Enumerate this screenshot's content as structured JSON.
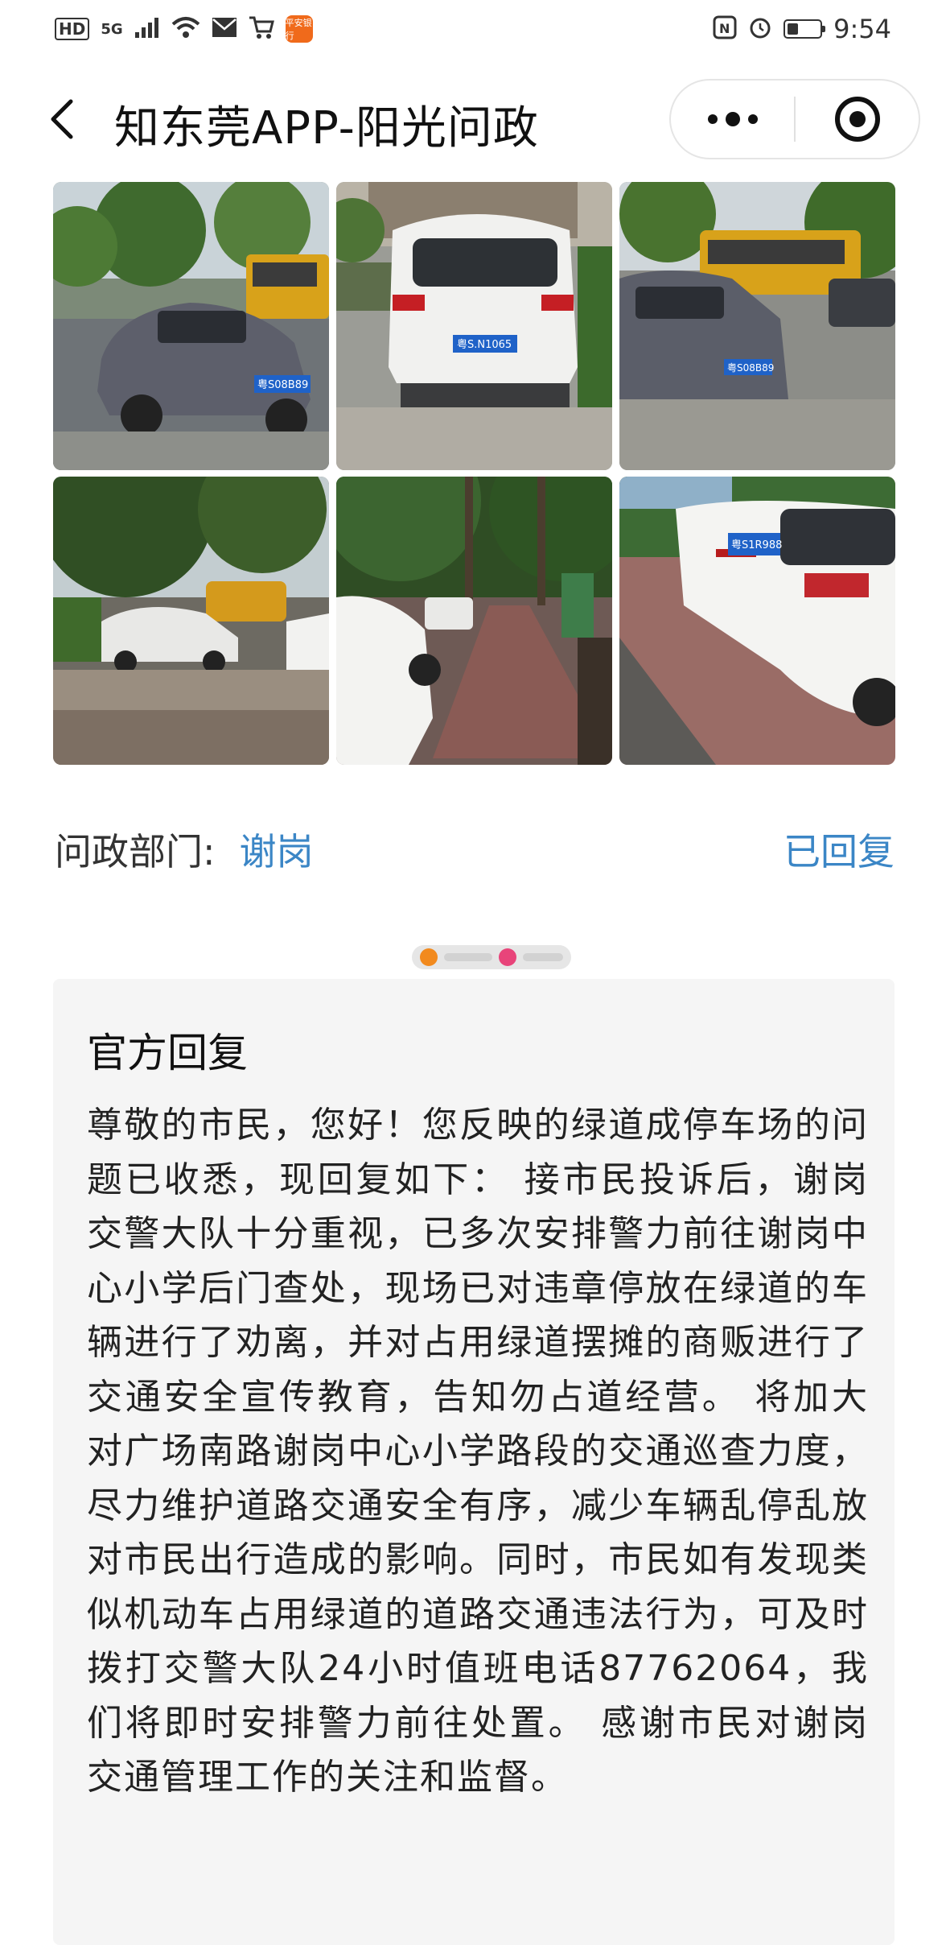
{
  "status_bar": {
    "left": [
      "HD",
      "5G"
    ],
    "app_badge": "平安银行",
    "time": "9:54",
    "icons": [
      "signal-icon",
      "wifi-icon",
      "mail-icon",
      "cart-icon",
      "nfc-icon",
      "alarm-icon",
      "battery-icon"
    ],
    "battery_level": 0.35
  },
  "header": {
    "title": "知东莞APP-阳光问政",
    "icons": [
      "back-icon",
      "more-icon",
      "record-icon"
    ]
  },
  "photos": [
    {
      "plate": "粤S08B89"
    },
    {
      "plate": "粤S.N1065"
    },
    {
      "plate": "粤S08B89"
    },
    {
      "plate": ""
    },
    {
      "plate": ""
    },
    {
      "plate": "粤S1R988"
    }
  ],
  "dept": {
    "label": "问政部门:",
    "value": "谢岗",
    "status": "已回复"
  },
  "reply": {
    "title": "官方回复",
    "body": "尊敬的市民，您好！您反映的绿道成停车场的问题已收悉，现回复如下： 接市民投诉后，谢岗交警大队十分重视，已多次安排警力前往谢岗中心小学后门查处，现场已对违章停放在绿道的车辆进行了劝离，并对占用绿道摆摊的商贩进行了交通安全宣传教育，告知勿占道经营。 将加大对广场南路谢岗中心小学路段的交通巡查力度，尽力维护道路交通安全有序，减少车辆乱停乱放对市民出行造成的影响。同时，市民如有发现类似机动车占用绿道的道路交通违法行为，可及时拨打交警大队24小时值班电话87762064，我们将即时安排警力前往处置。 感谢市民对谢岗交通管理工作的关注和监督。"
  },
  "colors": {
    "accent": "#3b86c6",
    "card_bg": "#f5f5f5"
  }
}
